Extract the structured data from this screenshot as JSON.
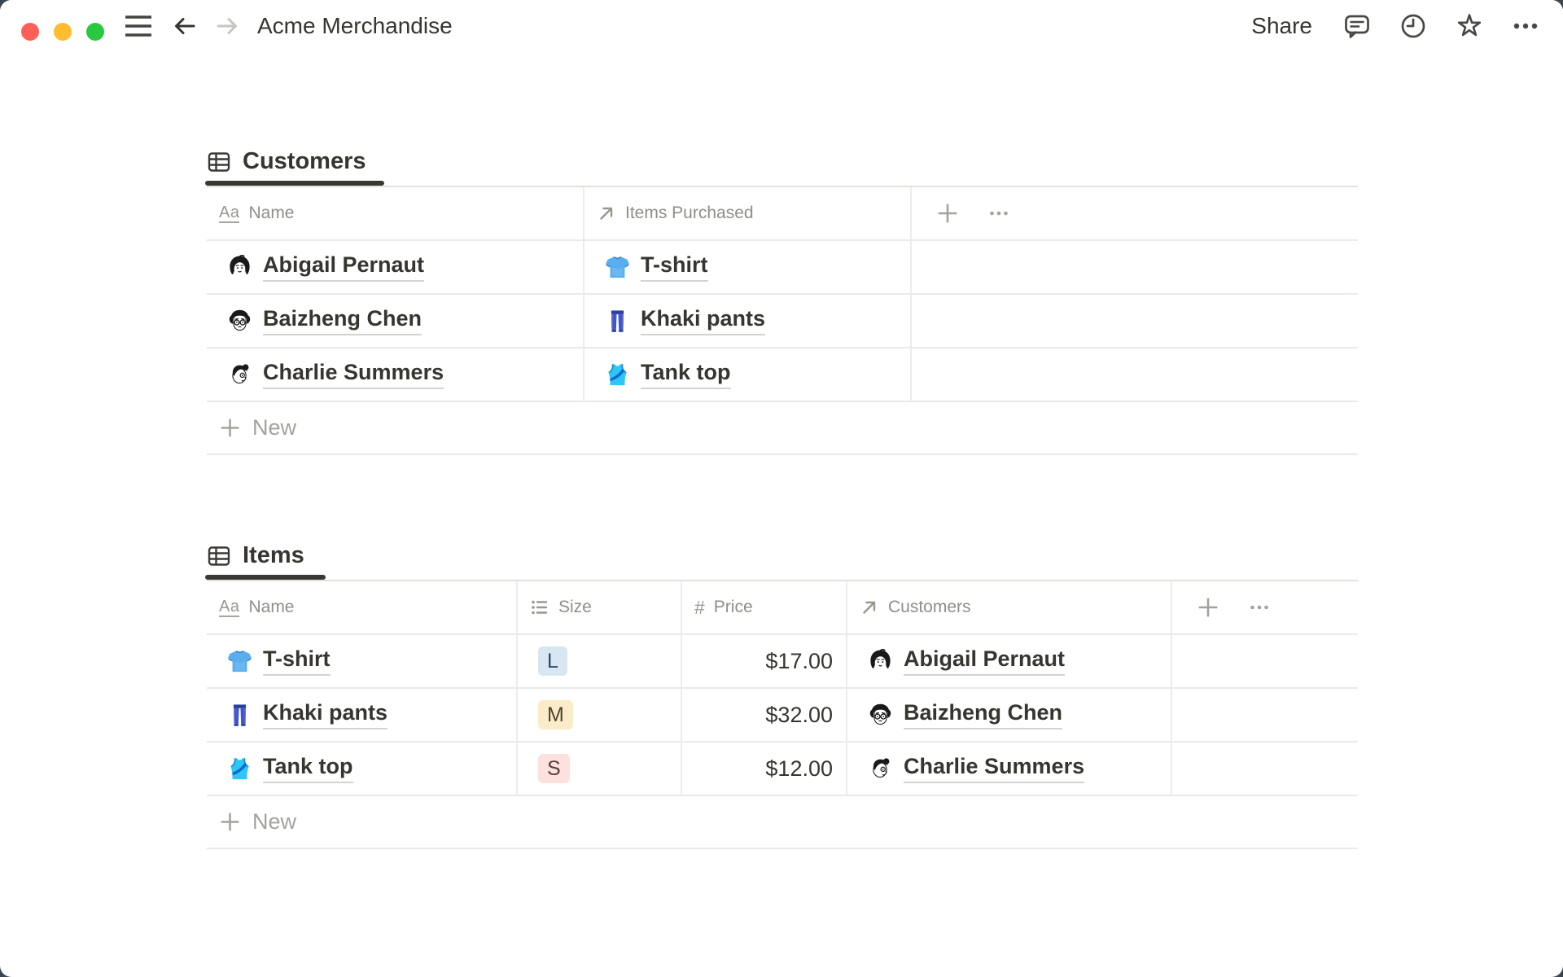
{
  "titlebar": {
    "title": "Acme Merchandise",
    "share_label": "Share"
  },
  "customers_table": {
    "tab_label": "Customers",
    "columns": [
      {
        "label": "Name",
        "type_icon": "text-property-icon"
      },
      {
        "label": "Items Purchased",
        "type_icon": "relation-property-icon"
      }
    ],
    "rows": [
      {
        "name": "Abigail Pernaut",
        "avatar_icon": "abigail-avatar-icon",
        "item": "T-shirt",
        "item_icon": "tshirt-icon"
      },
      {
        "name": "Baizheng Chen",
        "avatar_icon": "baizheng-avatar-icon",
        "item": "Khaki pants",
        "item_icon": "jeans-icon"
      },
      {
        "name": "Charlie Summers",
        "avatar_icon": "charlie-avatar-icon",
        "item": "Tank top",
        "item_icon": "tanktop-icon"
      }
    ],
    "new_label": "New"
  },
  "items_table": {
    "tab_label": "Items",
    "columns": [
      {
        "label": "Name",
        "type_icon": "text-property-icon"
      },
      {
        "label": "Size",
        "type_icon": "select-property-icon"
      },
      {
        "label": "Price",
        "type_icon": "number-property-icon"
      },
      {
        "label": "Customers",
        "type_icon": "relation-property-icon"
      }
    ],
    "rows": [
      {
        "name": "T-shirt",
        "icon": "tshirt-icon",
        "size": "L",
        "size_color": "#d7e6f0",
        "price": "$17.00",
        "customer": "Abigail Pernaut",
        "customer_avatar": "abigail-avatar-icon"
      },
      {
        "name": "Khaki pants",
        "icon": "jeans-icon",
        "size": "M",
        "size_color": "#fbecc9",
        "price": "$32.00",
        "customer": "Baizheng Chen",
        "customer_avatar": "baizheng-avatar-icon"
      },
      {
        "name": "Tank top",
        "icon": "tanktop-icon",
        "size": "S",
        "size_color": "#fde1dd",
        "price": "$12.00",
        "customer": "Charlie Summers",
        "customer_avatar": "charlie-avatar-icon"
      }
    ],
    "new_label": "New"
  },
  "colors": {
    "text_primary": "#37352f",
    "text_secondary": "#8f8e89",
    "row_border": "#eceae8",
    "active_tab_underline": "#3a3834",
    "chip_blue_bg": "#d7e6f0",
    "chip_yellow_bg": "#fbecc9",
    "chip_red_bg": "#fde1dd",
    "traffic_close": "#ff5f57",
    "traffic_minimize": "#febc2e",
    "traffic_zoom": "#28c840",
    "desktop_background": "#3a4750"
  }
}
